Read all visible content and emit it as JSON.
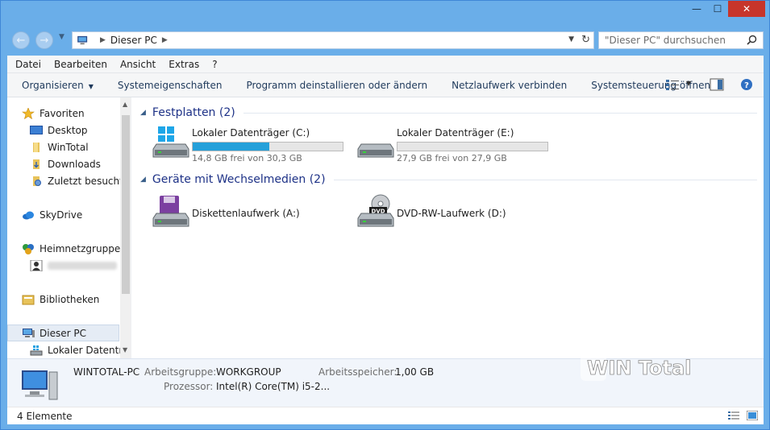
{
  "window": {
    "minimize_glyph": "—",
    "maximize_glyph": "☐",
    "close_glyph": "✕"
  },
  "address": {
    "breadcrumb": "Dieser PC",
    "search_placeholder": "\"Dieser PC\" durchsuchen"
  },
  "menu": {
    "items": [
      "Datei",
      "Bearbeiten",
      "Ansicht",
      "Extras",
      "?"
    ]
  },
  "toolbar": {
    "organize": "Organisieren",
    "system_properties": "Systemeigenschaften",
    "uninstall": "Programm deinstallieren oder ändern",
    "map_drive": "Netzlaufwerk verbinden",
    "control_panel": "Systemsteuerung öffnen"
  },
  "nav": {
    "favorites": "Favoriten",
    "desktop": "Desktop",
    "wintotal": "WinTotal",
    "downloads": "Downloads",
    "recent": "Zuletzt besucht",
    "skydrive": "SkyDrive",
    "homegroup": "Heimnetzgruppe",
    "libraries": "Bibliotheken",
    "this_pc": "Dieser PC",
    "local_drive": "Lokaler Datenträger"
  },
  "groups": {
    "hard_disks": "Festplatten (2)",
    "removable": "Geräte mit Wechselmedien (2)"
  },
  "drives": {
    "c": {
      "name": "Lokaler Datenträger (C:)",
      "info": "14,8 GB frei von 30,3 GB",
      "used_fraction": 0.51
    },
    "e": {
      "name": "Lokaler Datenträger (E:)",
      "info": "27,9 GB frei von 27,9 GB",
      "used_fraction": 0.0
    },
    "a": {
      "name": "Diskettenlaufwerk (A:)"
    },
    "d": {
      "name": "DVD-RW-Laufwerk (D:)",
      "badge": "DVD"
    }
  },
  "details": {
    "pc_name": "WINTOTAL-PC",
    "workgroup_label": "Arbeitsgruppe:",
    "workgroup": "WORKGROUP",
    "memory_label": "Arbeitsspeicher:",
    "memory": "1,00 GB",
    "cpu_label": "Prozessor:",
    "cpu": "Intel(R) Core(TM) i5-2..."
  },
  "status": {
    "count": "4 Elemente"
  },
  "watermark": {
    "text": "WIN Total"
  },
  "colors": {
    "accent": "#26a0da",
    "title_bar": "#6aaee9",
    "group_title": "#1e3287"
  }
}
